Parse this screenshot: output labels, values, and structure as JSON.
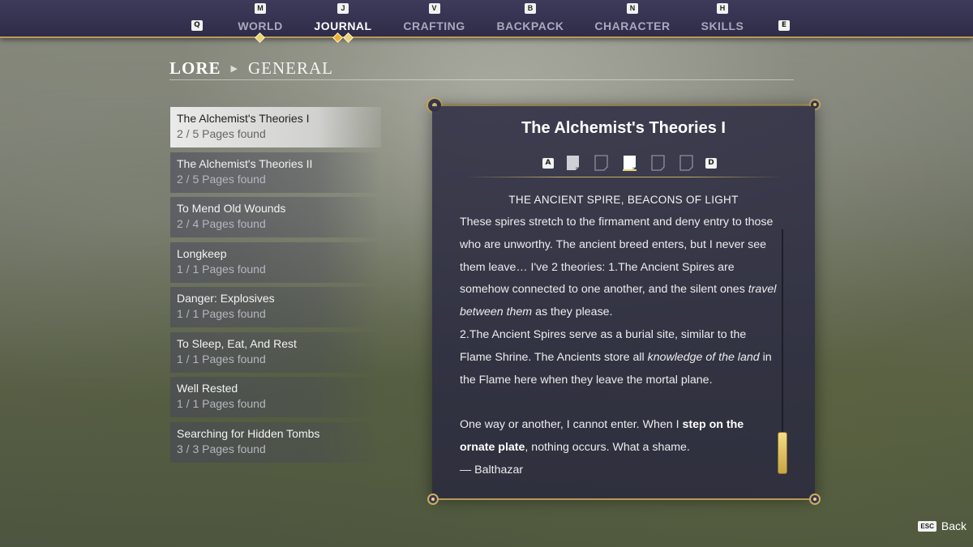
{
  "nav": {
    "left_key": "Q",
    "right_key": "E",
    "tabs": [
      {
        "key": "M",
        "label": "WORLD"
      },
      {
        "key": "J",
        "label": "JOURNAL"
      },
      {
        "key": "V",
        "label": "CRAFTING"
      },
      {
        "key": "B",
        "label": "BACKPACK"
      },
      {
        "key": "N",
        "label": "CHARACTER"
      },
      {
        "key": "H",
        "label": "SKILLS"
      }
    ],
    "active_tab": "JOURNAL"
  },
  "breadcrumb": {
    "main": "LORE",
    "sub": "GENERAL"
  },
  "lore_list": [
    {
      "title": "The Alchemist's Theories I",
      "count": "2 / 5 Pages found"
    },
    {
      "title": "The Alchemist's Theories II",
      "count": "2 / 5 Pages found"
    },
    {
      "title": "To Mend Old Wounds",
      "count": "2 / 4 Pages found"
    },
    {
      "title": "Longkeep",
      "count": "1 / 1 Pages found"
    },
    {
      "title": "Danger: Explosives",
      "count": "1 / 1 Pages found"
    },
    {
      "title": "To Sleep, Eat, And Rest",
      "count": "1 / 1 Pages found"
    },
    {
      "title": "Well Rested",
      "count": "1 / 1 Pages found"
    },
    {
      "title": "Searching for Hidden Tombs",
      "count": "3 / 3 Pages found"
    }
  ],
  "detail": {
    "title": "The Alchemist's Theories I",
    "prev_key": "A",
    "next_key": "D",
    "pages": [
      {
        "state": "found"
      },
      {
        "state": "missing"
      },
      {
        "state": "current"
      },
      {
        "state": "missing"
      },
      {
        "state": "missing"
      }
    ],
    "entry_heading": "THE ANCIENT SPIRE, BEACONS OF LIGHT",
    "body": {
      "p1_a": "These spires stretch to the firmament and deny entry to those who are unworthy. The ancient breed enters, but I never see them leave… I've 2 theories: 1.The Ancient Spires are somehow connected to one another, and the silent ones ",
      "p1_i": "travel between them",
      "p1_b": " as they please.",
      "p2_a": "2.The Ancient Spires serve as a burial site, similar to the Flame Shrine. The Ancients store all ",
      "p2_i": "knowledge of the land",
      "p2_b": " in the Flame here when they leave the mortal plane.",
      "p3_a": "One way or another, I cannot enter. When I ",
      "p3_bold": "step on the ornate plate",
      "p3_b": ", nothing occurs. What a shame.",
      "signature": "— Balthazar"
    }
  },
  "back": {
    "key": "ESC",
    "label": "Back"
  },
  "colors": {
    "accent_gold": "#c9ad62",
    "topbar": "#3d3b5a",
    "panel": "#343448"
  }
}
